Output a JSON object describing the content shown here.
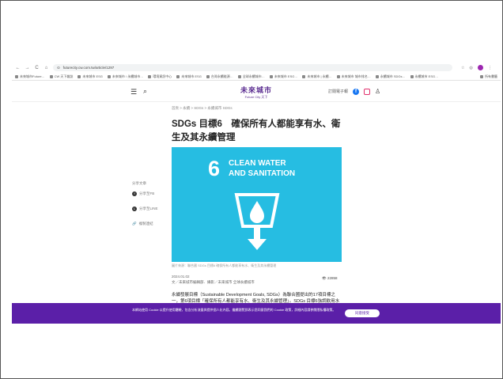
{
  "browser": {
    "url": "futurecity.cw.com.tw/article/1297",
    "nav": {
      "back": "←",
      "forward": "→",
      "reload": "C",
      "home": "⌂"
    },
    "bookmarks": [
      "未來城市Future…",
      "CW 天下雜誌",
      "未來城市 ESG",
      "未來城市 / 永續城市…",
      "環境資訊中心",
      "未來城市 ESG",
      "台灣永續能源…",
      "全球永續城市…",
      "未來城市 ESG…",
      "未來城市 | 永續…",
      "未來城市 城市排名…",
      "永續城市 SDGs…",
      "永續城市 ESG…"
    ],
    "bookmarks_right": "所有書籤"
  },
  "site": {
    "logo_main": "未來城市",
    "logo_sub": "Future City 天下",
    "header_link": "訂閱電子報",
    "colors": {
      "brand": "#5b2d91",
      "hero": "#26bde2",
      "cookie": "#5b1fa8"
    }
  },
  "article": {
    "breadcrumb": "首頁 > 永續 > SDGs > 永續城市 SDGs",
    "title": "SDGs 目標6　確保所有人都能享有水、衛生及其永續管理",
    "hero_number": "6",
    "hero_text_line1": "CLEAN WATER",
    "hero_text_line2": "AND SANITATION",
    "caption": "圖片來源：聯合國 SDGs 目標6 確保所有人都能享有水、衛生及其永續管理",
    "date": "2024.01.02",
    "byline": "文／未來城市編輯部．攝影／未來城市 全球永續城市",
    "views": "22858",
    "body": "永續發展目標（Sustainable Development Goals, SDGs）為聯合國提出的17項目標之一，第6項目標「確保所有人都能享有水、衛生及其永續管理」。SDGs 目標6強調飲用水安全與衛生設施"
  },
  "share": {
    "title": "分享文章",
    "facebook": "分享至FB",
    "line": "分享至LINE",
    "copy": "複製連結"
  },
  "cookie": {
    "text": "本網站使用 Cookie 以提升使用體驗，包含分析流量與提供個人化內容。繼續瀏覽即表示您同意我們的 Cookie 政策，詳細內容請參閱隱私權政策。",
    "button": "同意接受"
  }
}
